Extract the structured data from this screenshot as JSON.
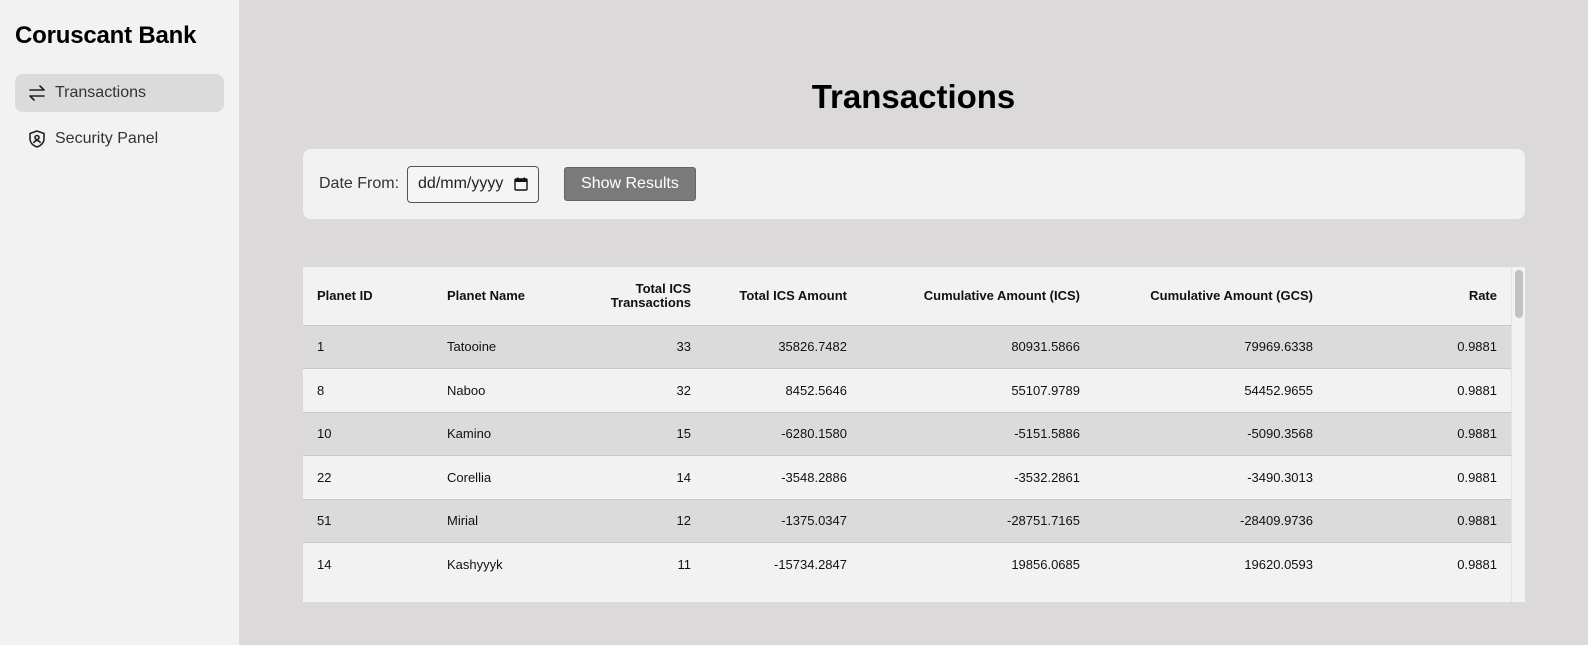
{
  "sidebar": {
    "brand": "Coruscant Bank",
    "items": [
      {
        "label": "Transactions",
        "icon": "arrows-swap-icon",
        "active": true
      },
      {
        "label": "Security Panel",
        "icon": "shield-icon",
        "active": false
      }
    ]
  },
  "main": {
    "title": "Transactions",
    "filter": {
      "date_from_label": "Date From:",
      "date_placeholder": "dd/mm/yyyy",
      "button_label": "Show Results"
    },
    "table": {
      "headers": [
        "Planet ID",
        "Planet Name",
        "Total ICS Transactions",
        "Total ICS Amount",
        "Cumulative Amount (ICS)",
        "Cumulative Amount (GCS)",
        "Rate"
      ],
      "rows": [
        [
          "1",
          "Tatooine",
          "33",
          "35826.7482",
          "80931.5866",
          "79969.6338",
          "0.9881"
        ],
        [
          "8",
          "Naboo",
          "32",
          "8452.5646",
          "55107.9789",
          "54452.9655",
          "0.9881"
        ],
        [
          "10",
          "Kamino",
          "15",
          "-6280.1580",
          "-5151.5886",
          "-5090.3568",
          "0.9881"
        ],
        [
          "22",
          "Corellia",
          "14",
          "-3548.2886",
          "-3532.2861",
          "-3490.3013",
          "0.9881"
        ],
        [
          "51",
          "Mirial",
          "12",
          "-1375.0347",
          "-28751.7165",
          "-28409.9736",
          "0.9881"
        ],
        [
          "14",
          "Kashyyyk",
          "11",
          "-15734.2847",
          "19856.0685",
          "19620.0593",
          "0.9881"
        ]
      ]
    }
  }
}
